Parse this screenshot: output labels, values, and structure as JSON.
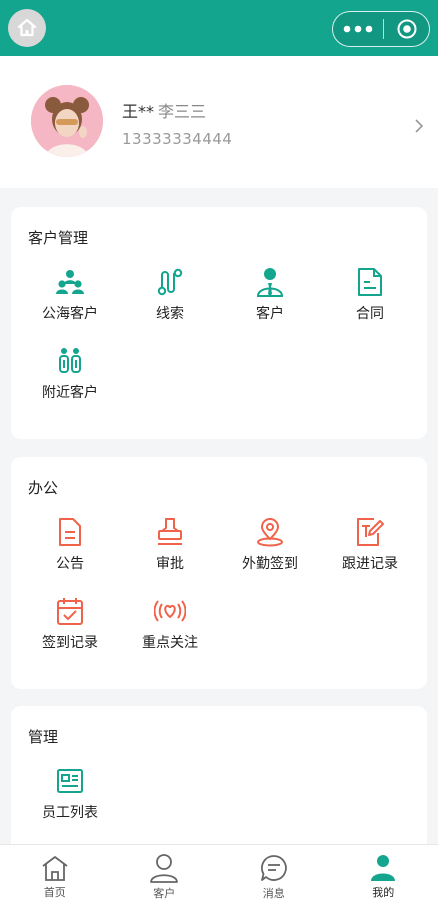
{
  "header": {
    "bg": "#14a58e"
  },
  "profile": {
    "name": "王**",
    "alias": "李三三",
    "phone": "13333334444"
  },
  "sections": [
    {
      "title": "客户管理",
      "items": [
        {
          "label": "公海客户",
          "icon": "group-icon"
        },
        {
          "label": "线索",
          "icon": "path-icon"
        },
        {
          "label": "客户",
          "icon": "person-tie-icon"
        },
        {
          "label": "合同",
          "icon": "document-icon"
        },
        {
          "label": "附近客户",
          "icon": "nearby-people-icon"
        }
      ]
    },
    {
      "title": "办公",
      "items": [
        {
          "label": "公告",
          "icon": "notice-icon"
        },
        {
          "label": "审批",
          "icon": "stamp-icon"
        },
        {
          "label": "外勤签到",
          "icon": "location-pin-icon"
        },
        {
          "label": "跟进记录",
          "icon": "edit-note-icon"
        },
        {
          "label": "签到记录",
          "icon": "calendar-check-icon"
        },
        {
          "label": "重点关注",
          "icon": "heart-signal-icon"
        }
      ]
    },
    {
      "title": "管理",
      "items": [
        {
          "label": "员工列表",
          "icon": "employee-list-icon"
        }
      ]
    }
  ],
  "tabbar": [
    {
      "label": "首页",
      "icon": "home-icon",
      "active": false
    },
    {
      "label": "客户",
      "icon": "customer-icon",
      "active": false
    },
    {
      "label": "消息",
      "icon": "message-icon",
      "active": false
    },
    {
      "label": "我的",
      "icon": "me-icon",
      "active": true
    }
  ],
  "colors": {
    "teal": "#14a58e",
    "coral": "#f0634a"
  }
}
